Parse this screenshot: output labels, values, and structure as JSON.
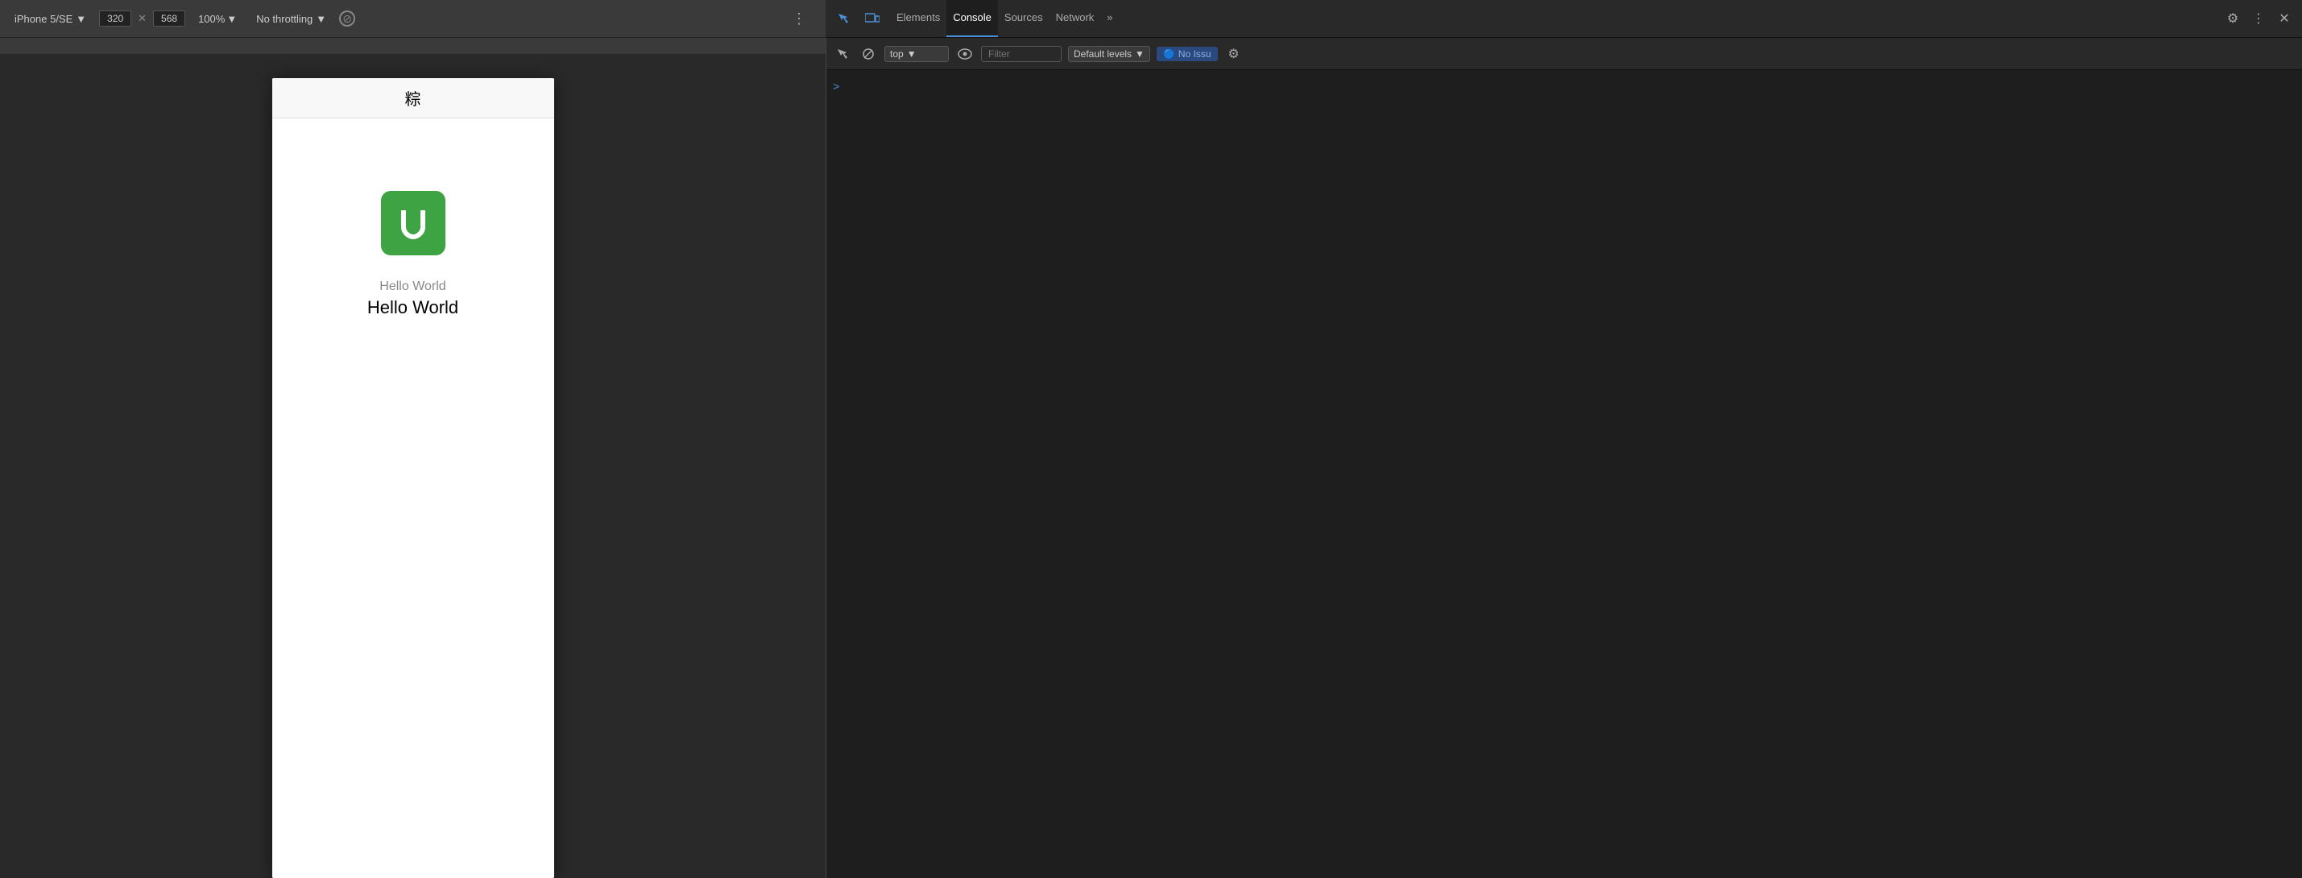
{
  "toolbar": {
    "device": "iPhone 5/SE",
    "device_dropdown_icon": "▼",
    "width": "320",
    "height": "568",
    "zoom": "100%",
    "zoom_icon": "▼",
    "throttle": "No throttling",
    "throttle_icon": "▼",
    "dots_icon": "⋮"
  },
  "devtools": {
    "tabs": [
      {
        "id": "elements",
        "label": "Elements",
        "active": false
      },
      {
        "id": "console",
        "label": "Console",
        "active": true
      },
      {
        "id": "sources",
        "label": "Sources",
        "active": false
      },
      {
        "id": "network",
        "label": "Network",
        "active": false
      }
    ],
    "more_tabs_icon": "»",
    "settings_icon": "⚙",
    "close_icon": "✕",
    "more_vert_icon": "⋮"
  },
  "console_toolbar": {
    "ban_icon": "🚫",
    "context": "top",
    "context_icon": "▼",
    "eye_label": "👁",
    "filter_placeholder": "Filter",
    "filter_value": "",
    "levels": "Default levels",
    "levels_icon": "▼",
    "no_issues": "No Issu",
    "settings_icon": "⚙"
  },
  "console_output": {
    "prompt_symbol": ">"
  },
  "device_screen": {
    "status_bar_char": "粽",
    "logo_letter": "U",
    "subtitle": "Hello World",
    "title": "Hello World"
  }
}
